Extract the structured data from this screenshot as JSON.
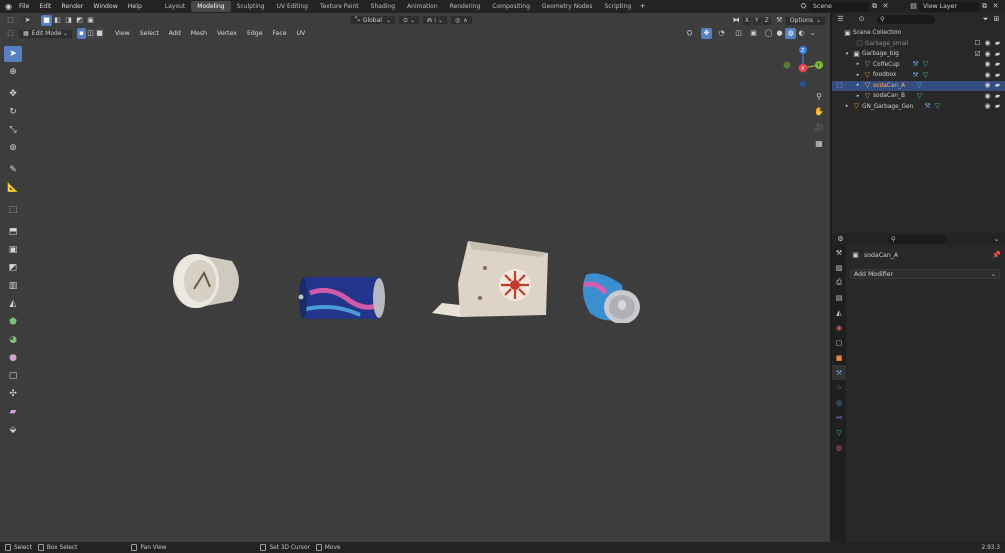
{
  "app": {
    "logo_icon": "blender-logo-icon"
  },
  "menus": [
    "File",
    "Edit",
    "Render",
    "Window",
    "Help"
  ],
  "workspaces": [
    "Layout",
    "Modeling",
    "Sculpting",
    "UV Editing",
    "Texture Paint",
    "Shading",
    "Animation",
    "Rendering",
    "Compositing",
    "Geometry Nodes",
    "Scripting"
  ],
  "active_workspace": "Modeling",
  "scene": {
    "name": "Scene",
    "view_layer": "View Layer"
  },
  "viewport": {
    "mode": "Edit Mode",
    "menus": [
      "View",
      "Select",
      "Add",
      "Mesh",
      "Vertex",
      "Edge",
      "Face",
      "UV"
    ],
    "orientation": "Global",
    "options_label": "Options",
    "axes": {
      "x": "X",
      "y": "Y",
      "z": "Z"
    }
  },
  "outliner": {
    "items": [
      {
        "label": "Scene Collection",
        "depth": 0,
        "type": "scene"
      },
      {
        "label": "Garbage_small",
        "depth": 1,
        "type": "collection",
        "dim": true
      },
      {
        "label": "Garbage_big",
        "depth": 1,
        "type": "collection"
      },
      {
        "label": "CoffeCup",
        "depth": 2,
        "type": "object"
      },
      {
        "label": "foodbox",
        "depth": 2,
        "type": "object"
      },
      {
        "label": "sodaCan_A",
        "depth": 2,
        "type": "object",
        "selected": true
      },
      {
        "label": "sodaCan_B",
        "depth": 2,
        "type": "object"
      },
      {
        "label": "GN_Garbage_Gen",
        "depth": 1,
        "type": "object"
      }
    ]
  },
  "properties": {
    "object_name": "sodaCan_A",
    "add_modifier_label": "Add Modifier"
  },
  "status": {
    "items": [
      "Select",
      "Box Select",
      "Pan View",
      "Set 3D Cursor",
      "Move"
    ],
    "version": "2.93.3"
  },
  "colors": {
    "accent": "#5680c2",
    "selection": "#334d80",
    "viewport_bg": "#3d3d3d",
    "x_axis": "#e0404f",
    "y_axis": "#7fbd3b",
    "z_axis": "#3b7fe0"
  }
}
